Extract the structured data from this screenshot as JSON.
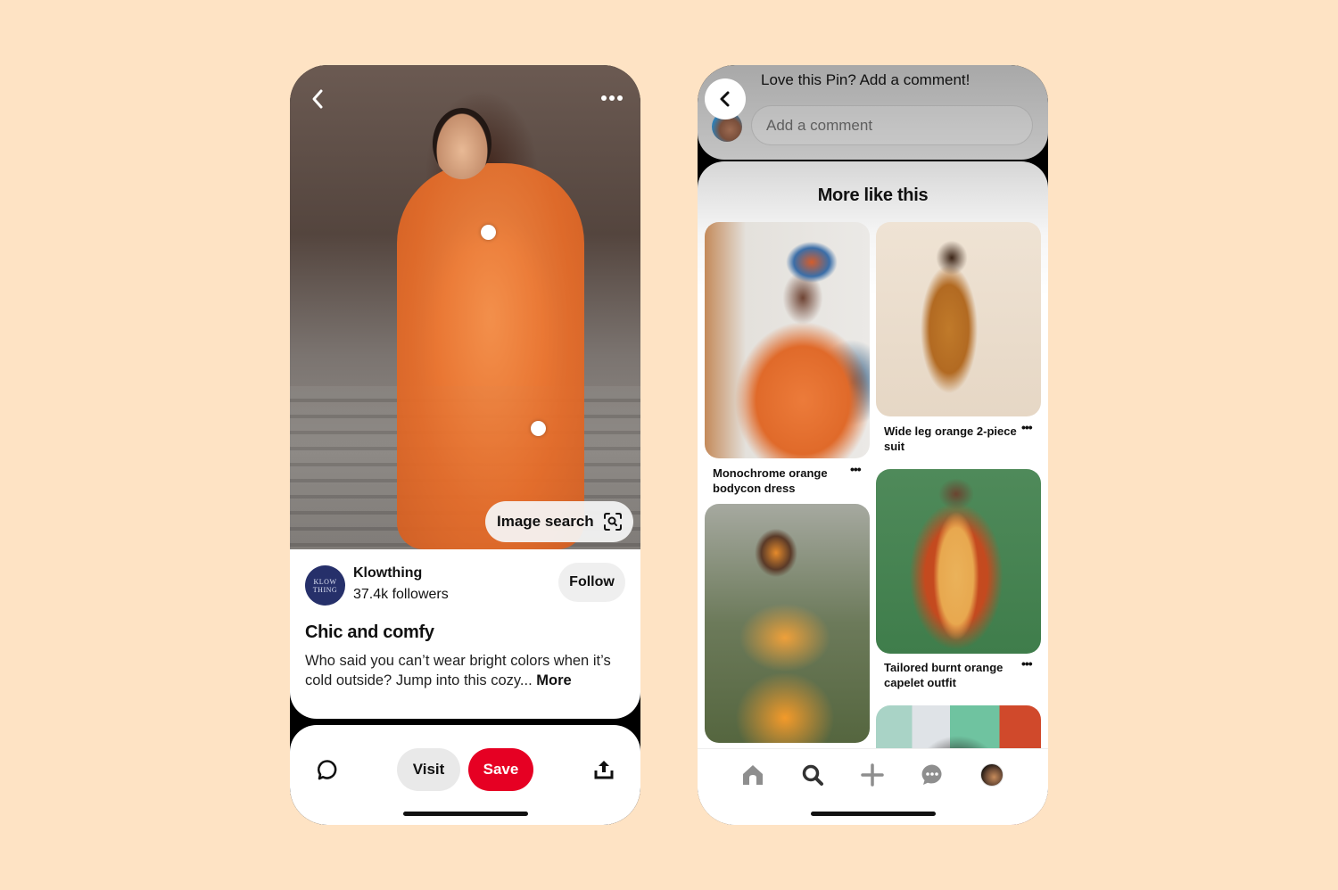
{
  "colors": {
    "background": "#fee3c4",
    "save_red": "#e60023",
    "creator_avatar": "#26306a"
  },
  "pin_screen": {
    "top_bar": {
      "back_icon": "chevron-left-icon",
      "more_icon": "ellipsis-icon"
    },
    "image_search_label": "Image search",
    "image_search_icon": "visual-search-icon",
    "creator": {
      "avatar_text_line1": "KLOW",
      "avatar_text_line2": "THING",
      "name": "Klowthing",
      "followers": "37.4k followers"
    },
    "follow_label": "Follow",
    "title": "Chic and comfy",
    "description": "Who said you can’t wear bright colors when it’s cold outside? Jump into this cozy... ",
    "more_label": "More",
    "action_bar": {
      "comment_icon": "speech-bubble-icon",
      "visit_label": "Visit",
      "save_label": "Save",
      "share_icon": "share-upload-icon"
    }
  },
  "feed_screen": {
    "comment_prompt": "Love this Pin? Add a comment!",
    "comment_placeholder": "Add a comment",
    "section_title": "More like this",
    "pins": [
      {
        "caption": "Monochrome orange bodycon dress"
      },
      {
        "caption": "Wide leg orange 2-piece suit"
      },
      {
        "caption": ""
      },
      {
        "caption": "Tailored burnt orange capelet outfit"
      },
      {
        "caption": ""
      }
    ],
    "more_glyph": "•••",
    "tab_bar": [
      {
        "icon": "home-icon",
        "active": false
      },
      {
        "icon": "search-icon",
        "active": true
      },
      {
        "icon": "plus-icon",
        "active": false
      },
      {
        "icon": "messages-icon",
        "active": false
      },
      {
        "icon": "profile-avatar",
        "active": false
      }
    ]
  }
}
